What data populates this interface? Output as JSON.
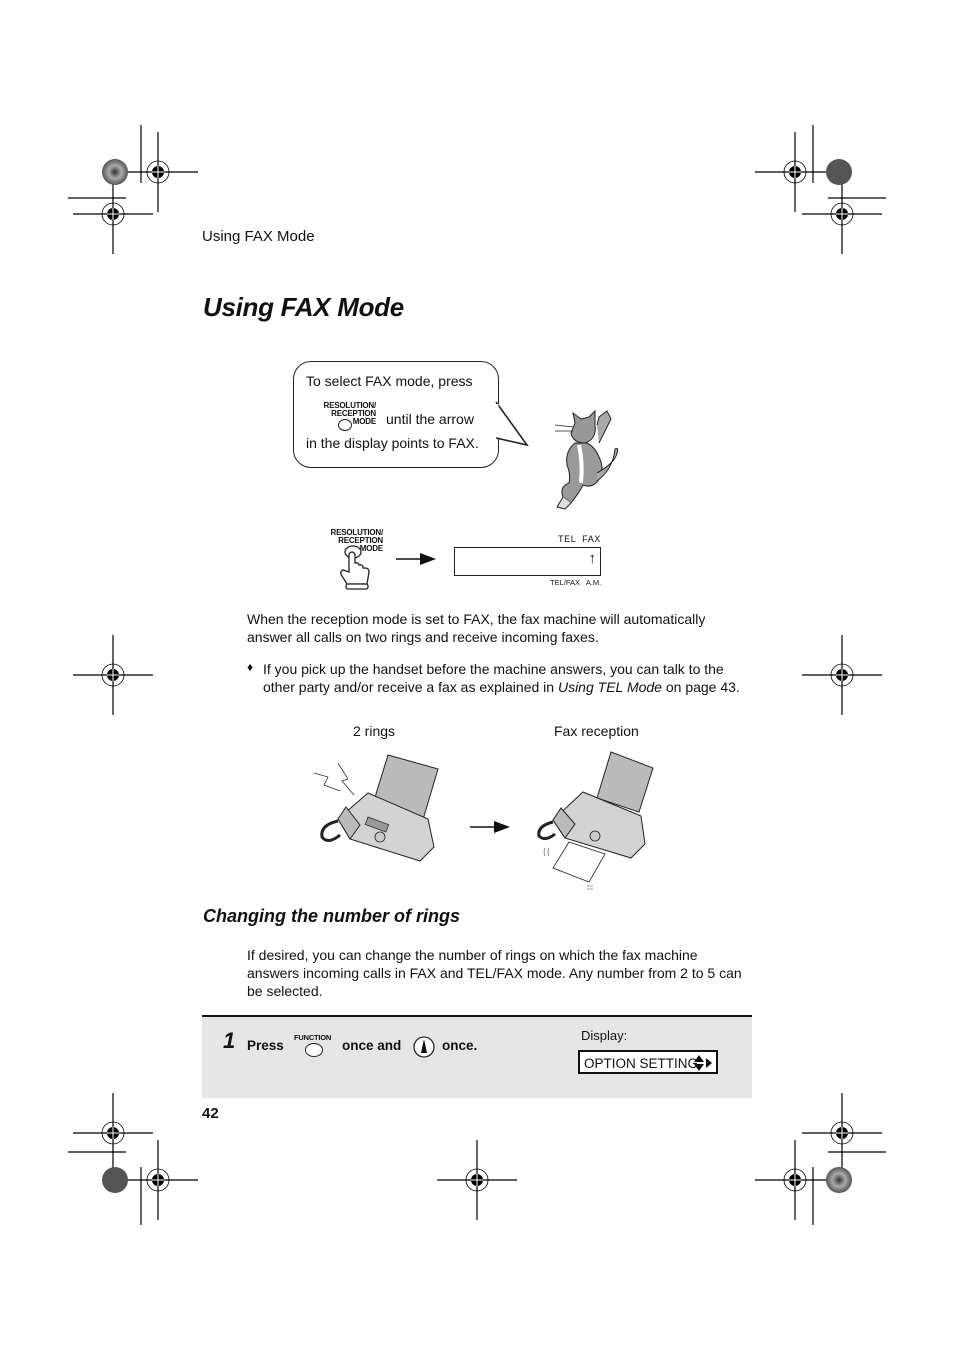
{
  "header": {
    "running_title": "Using FAX Mode"
  },
  "page_title": "Using FAX Mode",
  "callout": {
    "line1": "To select FAX mode, press",
    "button_label_line1": "RESOLUTION/",
    "button_label_line2": "RECEPTION MODE",
    "line2": "until the arrow",
    "line3": "in the display points to FAX."
  },
  "mode_diagram": {
    "button_label_line1": "RESOLUTION/",
    "button_label_line2": "RECEPTION MODE",
    "display_top": "TEL  FAX",
    "display_bottom": "TEL/FAX   A.M.",
    "arrow_glyph": "↑"
  },
  "body": {
    "paragraph1": "When the reception mode is set to FAX, the fax machine will automatically answer all calls on two rings and receive incoming faxes.",
    "bullet_glyph": "♦",
    "bullet_text_before": "If you pick up the handset before the machine answers, you can talk to the other party and/or receive a fax as explained in ",
    "bullet_text_italic": "Using TEL Mode",
    "bullet_text_after": " on page 43."
  },
  "illustration": {
    "caption_left": "2 rings",
    "caption_right": "Fax reception"
  },
  "section": {
    "title": "Changing the number of rings",
    "paragraph": "If desired, you can change the number of rings on which the fax machine answers incoming calls in FAX and TEL/FAX mode. Any number from 2 to 5 can be selected."
  },
  "step1": {
    "number": "1",
    "press": "Press",
    "function_label": "FUNCTION",
    "once_and": "once and",
    "once": "once.",
    "display_label": "Display:",
    "display_value": "OPTION SETTING"
  },
  "page_number": "42"
}
